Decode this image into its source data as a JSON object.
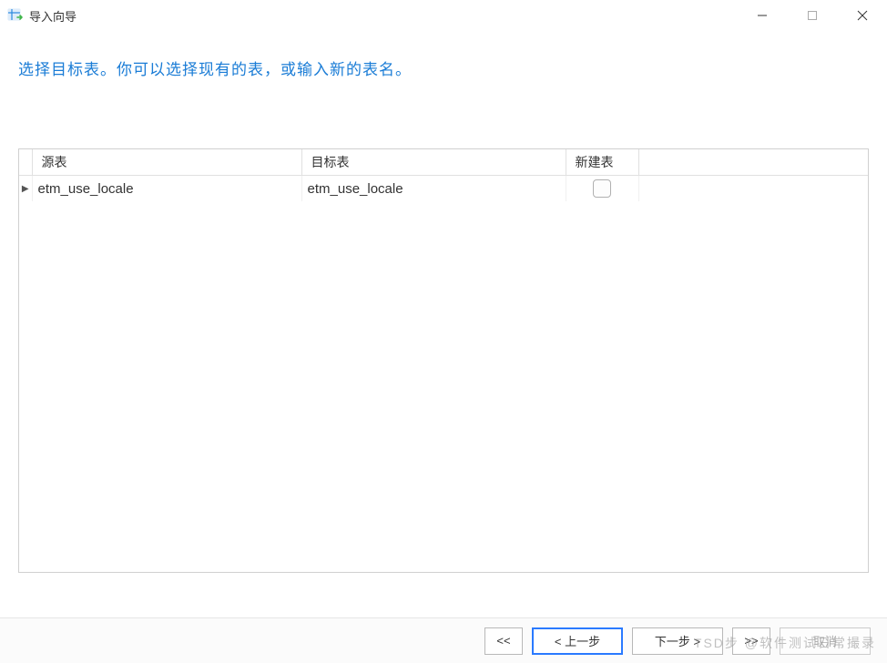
{
  "window": {
    "title": "导入向导"
  },
  "instruction": "选择目标表。你可以选择现有的表，或输入新的表名。",
  "table": {
    "headers": {
      "source": "源表",
      "target": "目标表",
      "new": "新建表"
    },
    "rows": [
      {
        "source": "etm_use_locale",
        "target": "etm_use_locale",
        "new": false
      }
    ]
  },
  "footer": {
    "first": "<<",
    "prev": "< 上一步",
    "next": "下一步 >",
    "last": ">>",
    "cancel": "取消"
  },
  "watermark": "TSD步 @软件测试日常撮录"
}
